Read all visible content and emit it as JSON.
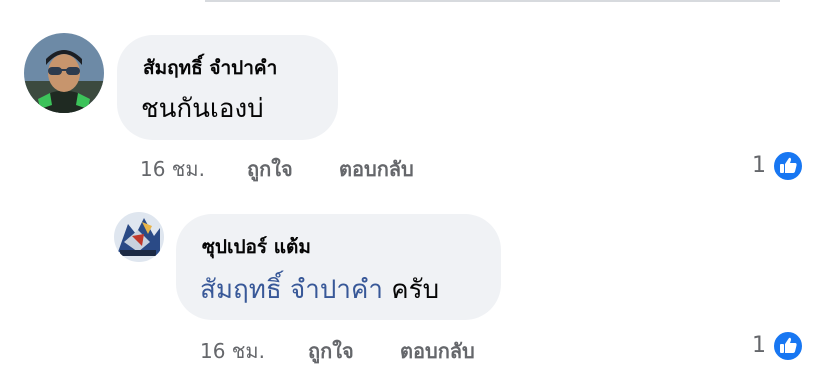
{
  "comments": [
    {
      "author": "สัมฤทธิ์ จำปาคำ",
      "text": "ชนกันเองบ่",
      "time": "16 ชม.",
      "like_action": "ถูกใจ",
      "reply_action": "ตอบกลับ",
      "reaction_count": "1",
      "reaction_icon": "like-icon"
    },
    {
      "author": "ซุปเปอร์ แต้ม",
      "mention": "สัมฤทธิ์ จำปาคำ",
      "text": " ครับ",
      "time": "16 ชม.",
      "like_action": "ถูกใจ",
      "reply_action": "ตอบกลับ",
      "reaction_count": "1",
      "reaction_icon": "like-icon"
    }
  ],
  "colors": {
    "bubble": "#f0f2f5",
    "mention": "#385898",
    "meta": "#65676b",
    "like": "#1877f2"
  }
}
